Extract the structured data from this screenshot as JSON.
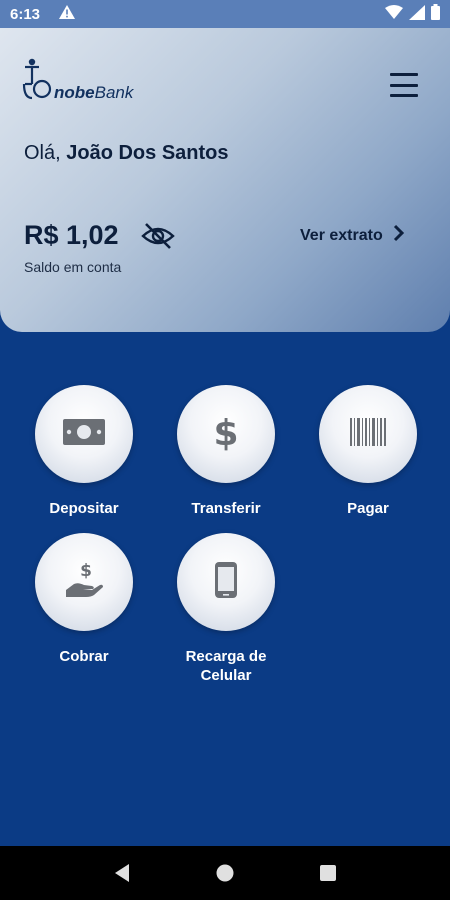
{
  "status_bar": {
    "time": "6:13",
    "icons": [
      "alert-triangle-icon",
      "wifi-icon",
      "signal-icon",
      "battery-icon"
    ]
  },
  "header": {
    "brand_prefix": "nobe",
    "brand_suffix": "Bank",
    "greeting_prefix": "Olá,",
    "user_name": "João Dos Santos",
    "balance": "R$ 1,02",
    "balance_label": "Saldo em conta",
    "statement_link": "Ver extrato"
  },
  "actions": [
    {
      "label": "Depositar",
      "icon": "cash-icon"
    },
    {
      "label": "Transferir",
      "icon": "dollar-icon"
    },
    {
      "label": "Pagar",
      "icon": "barcode-icon"
    },
    {
      "label": "Cobrar",
      "icon": "hand-money-icon"
    },
    {
      "label": "Recarga de Celular",
      "icon": "smartphone-icon"
    }
  ],
  "nav": [
    "back-icon",
    "home-icon",
    "recents-icon"
  ],
  "colors": {
    "background": "#0b3b85",
    "text_dark": "#0d1f3c",
    "icon_gray": "#6b6f75"
  }
}
